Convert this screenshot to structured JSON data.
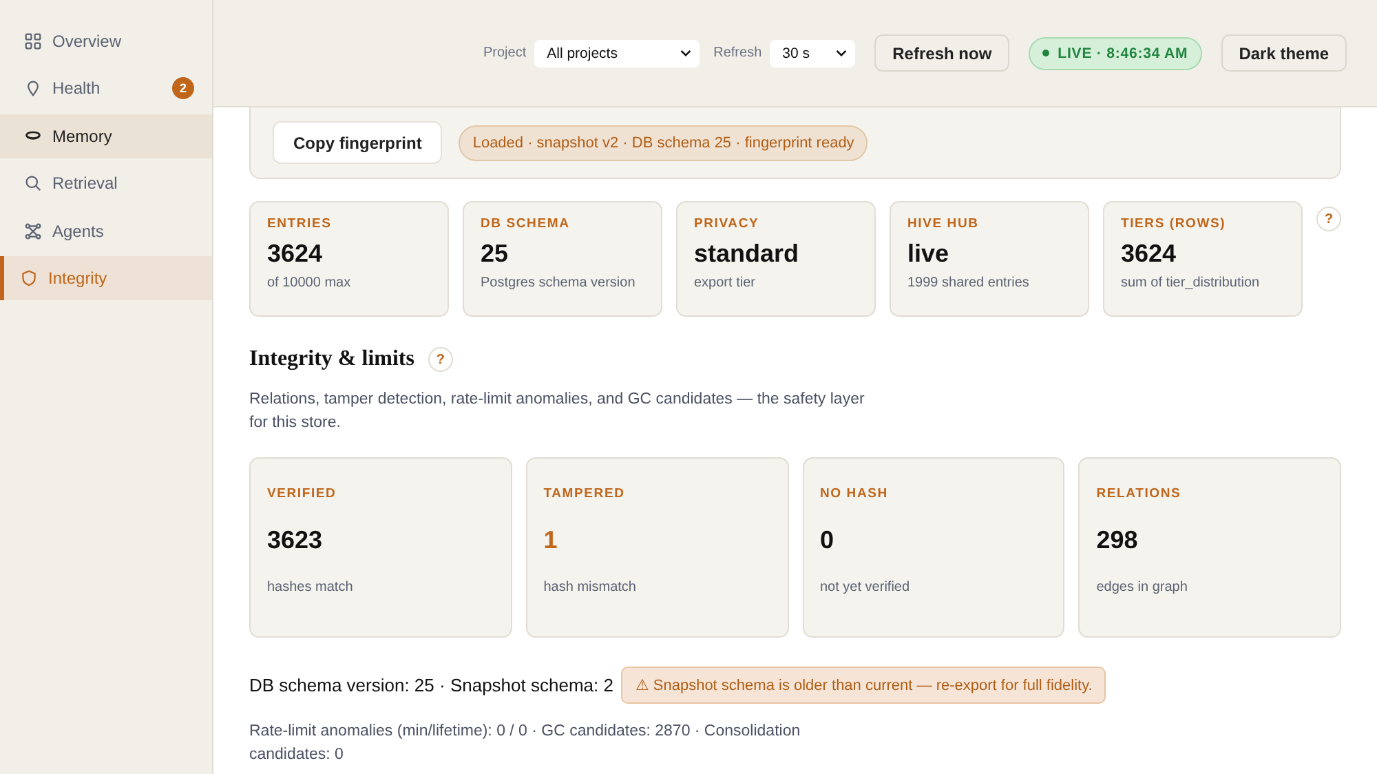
{
  "sidebar": {
    "items": [
      {
        "label": "Overview",
        "kind": "grid",
        "selected": false,
        "highlighted": false
      },
      {
        "label": "Health",
        "kind": "pin",
        "selected": false,
        "highlighted": false,
        "badge": "2"
      },
      {
        "label": "Memory",
        "kind": "bowl",
        "selected": false,
        "highlighted": true
      },
      {
        "label": "Retrieval",
        "kind": "search",
        "selected": false,
        "highlighted": false
      },
      {
        "label": "Agents",
        "kind": "network",
        "selected": false,
        "highlighted": false
      },
      {
        "label": "Integrity",
        "kind": "shield",
        "selected": true,
        "highlighted": false
      }
    ]
  },
  "header": {
    "project_label": "Project",
    "project_value": "All projects",
    "refresh_label": "Refresh",
    "refresh_value": "30 s",
    "refresh_button": "Refresh now",
    "live": "LIVE · 8:46:34 AM",
    "theme_button": "Dark theme"
  },
  "toolbar": {
    "copy_button": "Copy fingerprint",
    "status": "Loaded · snapshot v2 · DB schema 25 · fingerprint ready"
  },
  "stats": [
    {
      "label": "ENTRIES",
      "value": "3624",
      "note": "of 10000 max"
    },
    {
      "label": "DB SCHEMA",
      "value": "25",
      "note": "Postgres schema version"
    },
    {
      "label": "PRIVACY",
      "value": "standard",
      "note": "export tier"
    },
    {
      "label": "HIVE HUB",
      "value": "live",
      "note": "1999 shared entries"
    },
    {
      "label": "TIERS (ROWS)",
      "value": "3624",
      "note": "sum of tier_distribution"
    }
  ],
  "stats_help": "?",
  "section": {
    "title": "Integrity & limits",
    "help": "?",
    "description": "Relations, tamper detection, rate-limit anomalies, and GC candidates — the safety layer for this store.",
    "cards": [
      {
        "label": "VERIFIED",
        "value": "3623",
        "note": "hashes match",
        "alert": false
      },
      {
        "label": "TAMPERED",
        "value": "1",
        "note": "hash mismatch",
        "alert": true
      },
      {
        "label": "NO HASH",
        "value": "0",
        "note": "not yet verified",
        "alert": false
      },
      {
        "label": "RELATIONS",
        "value": "298",
        "note": "edges in graph",
        "alert": false
      }
    ],
    "schema_line": "DB schema version: 25 · Snapshot schema: 2",
    "warning": "⚠ Snapshot schema is older than current — re-export for full fidelity.",
    "limits": "Rate-limit anomalies (min/lifetime): 0 / 0 · GC candidates: 2870 · Consolidation candidates: 0"
  }
}
